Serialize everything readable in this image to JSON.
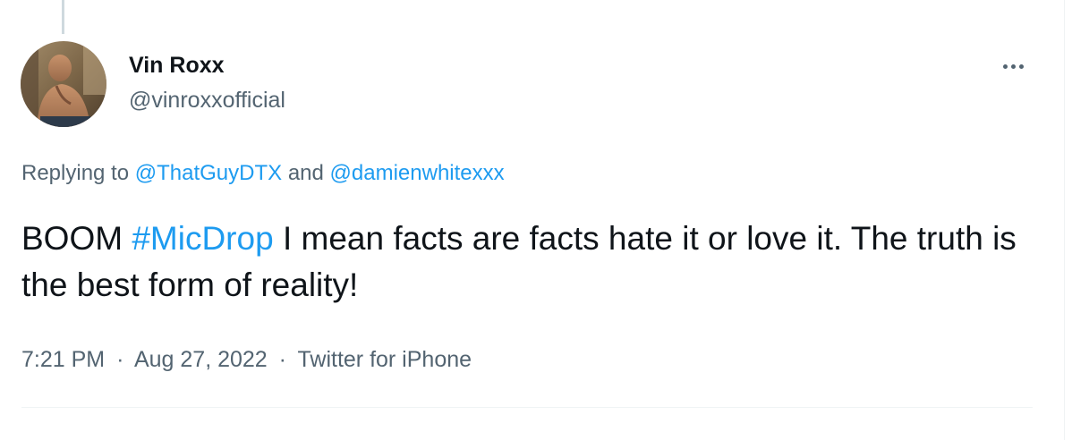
{
  "tweet": {
    "author": {
      "display_name": "Vin Roxx",
      "handle": "@vinroxxofficial",
      "avatar_icon": "profile-photo"
    },
    "more_icon": "more-horizontal-icon",
    "replying": {
      "prefix": "Replying to",
      "mention_1": "@ThatGuyDTX",
      "conjunction": "and",
      "mention_2": "@damienwhitexxx"
    },
    "text": {
      "before_hashtag": "BOOM",
      "hashtag": "#MicDrop",
      "after_hashtag": "I mean facts are facts hate it or love it. The truth is the best form of reality!"
    },
    "meta": {
      "time": "7:21 PM",
      "separator": "·",
      "date": "Aug 27, 2022",
      "source": "Twitter for iPhone"
    }
  },
  "colors": {
    "link": "#1d9bf0",
    "text_primary": "#0f1419",
    "text_secondary": "#536471",
    "border": "#eff3f4"
  }
}
